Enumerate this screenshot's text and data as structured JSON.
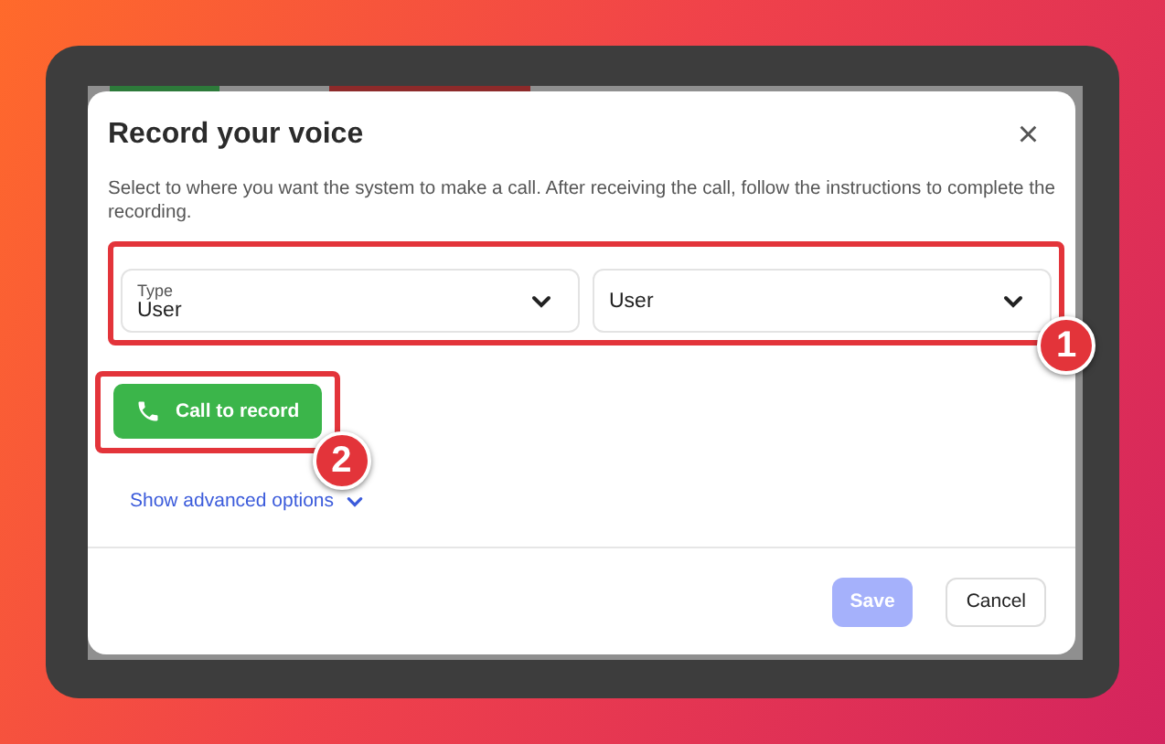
{
  "dialog": {
    "title": "Record your voice",
    "close": "×",
    "description": "Select to where you want the system to make a call. After receiving the call, follow the instructions to complete the recording.",
    "selects": [
      {
        "label": "Type",
        "value": "User"
      },
      {
        "value": "User"
      }
    ],
    "call_button": "Call to record",
    "advanced_link": "Show advanced options",
    "buttons": [
      {
        "label": "Save",
        "kind": "primary",
        "disabled": true
      },
      {
        "label": "Cancel",
        "kind": "secondary",
        "disabled": false
      }
    ]
  },
  "annotations": [
    {
      "number": "1"
    },
    {
      "number": "2"
    }
  ]
}
